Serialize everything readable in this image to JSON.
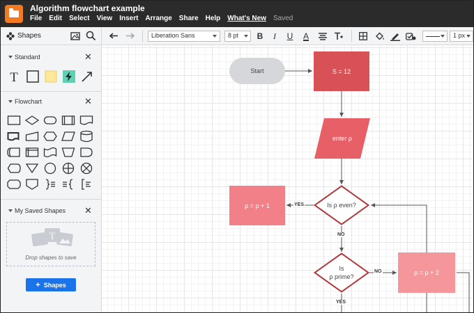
{
  "app": {
    "title": "Algorithm flowchart example",
    "menu": [
      "File",
      "Edit",
      "Select",
      "View",
      "Insert",
      "Arrange",
      "Share",
      "Help",
      "What's New"
    ],
    "status": "Saved",
    "brand_color": "#f47a22"
  },
  "shapes_header": {
    "title": "Shapes"
  },
  "toolbar": {
    "font": "Liberation Sans",
    "font_size": "8 pt",
    "bold": "B",
    "italic": "I",
    "underline": "U",
    "text_color": "A",
    "line_width": "1 px"
  },
  "sidebar": {
    "standard": {
      "label": "Standard"
    },
    "flowchart": {
      "label": "Flowchart"
    },
    "saved": {
      "label": "My Saved Shapes",
      "drop_text": "Drop shapes to save"
    },
    "button": {
      "label": "Shapes",
      "icon": "+"
    }
  },
  "diagram": {
    "nodes": {
      "start": "Start",
      "s12": "S = 12",
      "enter": "enter ρ",
      "even": "Is ρ even?",
      "prime_1": "Is",
      "prime_2": "ρ prime?",
      "p1": "ρ = ρ + 1",
      "p2": "ρ = ρ + 2"
    },
    "edge_labels": {
      "yes_left": "YES",
      "no_down": "NO",
      "no_right": "NO",
      "yes_down": "YES"
    },
    "colors": {
      "terminal": "#d5d7da",
      "process_dark": "#d85157",
      "process": "#f28088",
      "process_light": "#f5969b",
      "decision_border": "#b03a3e"
    }
  }
}
